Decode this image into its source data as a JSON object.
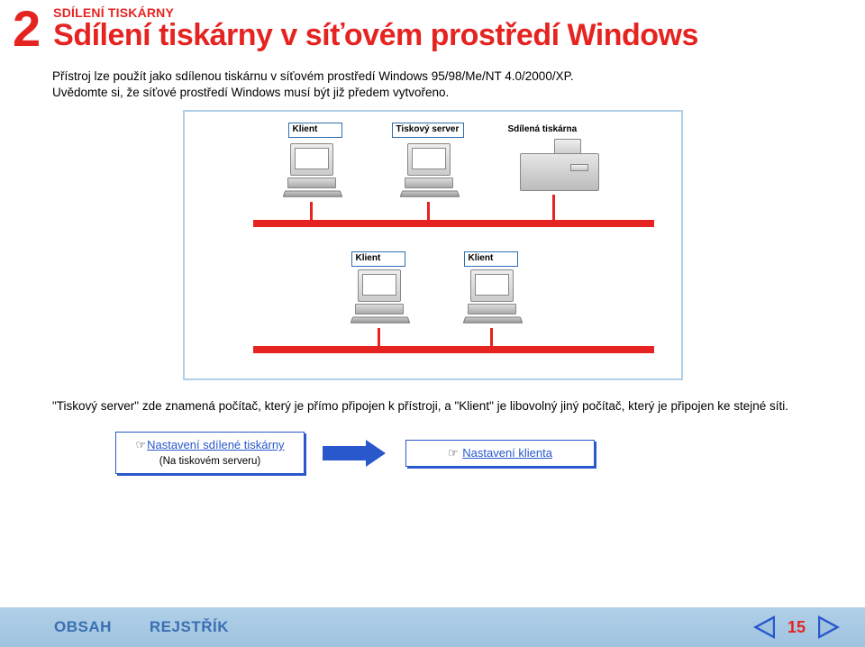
{
  "header": {
    "chapter_num": "2",
    "section_label": "SDÍLENÍ TISKÁRNY",
    "title": "Sdílení tiskárny v síťovém prostředí Windows"
  },
  "intro": {
    "line1": "Přístroj lze použít jako sdílenou tiskárnu v síťovém prostředí Windows 95/98/Me/NT 4.0/2000/XP.",
    "line2": "Uvědomte si, že síťové prostředí Windows musí být již předem vytvořeno."
  },
  "diagram": {
    "labels": {
      "client": "Klient",
      "print_server": "Tiskový server",
      "shared_printer": "Sdílená tiskárna"
    }
  },
  "explain": "\"Tiskový server\" zde znamená počítač, který je přímo připojen k přístroji, a \"Klient\" je libovolný jiný počítač, který je připojen ke stejné síti.",
  "steps": {
    "left": {
      "finger": "☞",
      "link": "Nastavení sdílené tiskárny",
      "sub": "(Na tiskovém serveru)"
    },
    "right": {
      "finger": "☞",
      "link": "Nastavení klienta"
    }
  },
  "footer": {
    "obsah": "OBSAH",
    "rejstrik": "REJSTŘÍK",
    "page": "15"
  }
}
